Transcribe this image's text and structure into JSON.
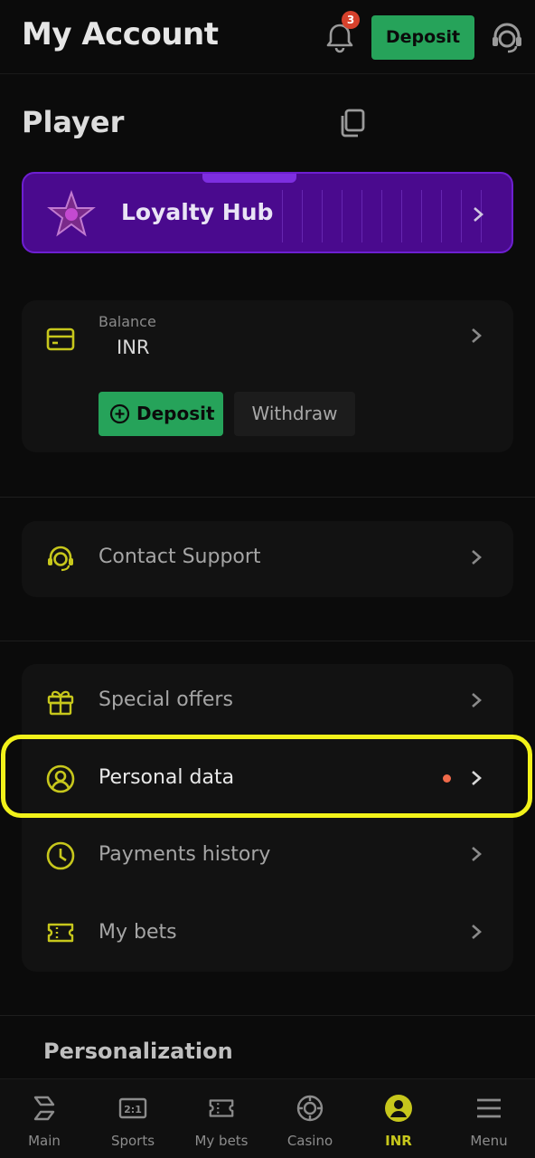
{
  "header": {
    "title": "My Account",
    "notification_count": "3",
    "deposit_label": "Deposit"
  },
  "player": {
    "title": "Player"
  },
  "loyalty": {
    "label": "Loyalty Hub"
  },
  "balance": {
    "label": "Balance",
    "value": "INR",
    "deposit_label": "Deposit",
    "withdraw_label": "Withdraw"
  },
  "support": {
    "label": "Contact Support"
  },
  "menu": {
    "items": [
      {
        "label": "Special offers",
        "icon": "gift-icon"
      },
      {
        "label": "Personal data",
        "icon": "user-circle-icon"
      },
      {
        "label": "Payments history",
        "icon": "clock-icon"
      },
      {
        "label": "My bets",
        "icon": "ticket-icon"
      }
    ]
  },
  "personalization": {
    "title": "Personalization"
  },
  "nav": {
    "items": [
      {
        "label": "Main",
        "icon": "main-icon"
      },
      {
        "label": "Sports",
        "icon": "sports-icon"
      },
      {
        "label": "My bets",
        "icon": "ticket-icon"
      },
      {
        "label": "Casino",
        "icon": "casino-chip-icon"
      },
      {
        "label": "INR",
        "icon": "user-circle-icon"
      },
      {
        "label": "Menu",
        "icon": "hamburger-icon"
      }
    ]
  },
  "colors": {
    "accent_green": "#26a35a",
    "icon_olive": "#c7c71c",
    "loyalty_purple": "#4a0a8e",
    "highlight_yellow": "#f2f21a",
    "badge_red": "#d6412c"
  }
}
